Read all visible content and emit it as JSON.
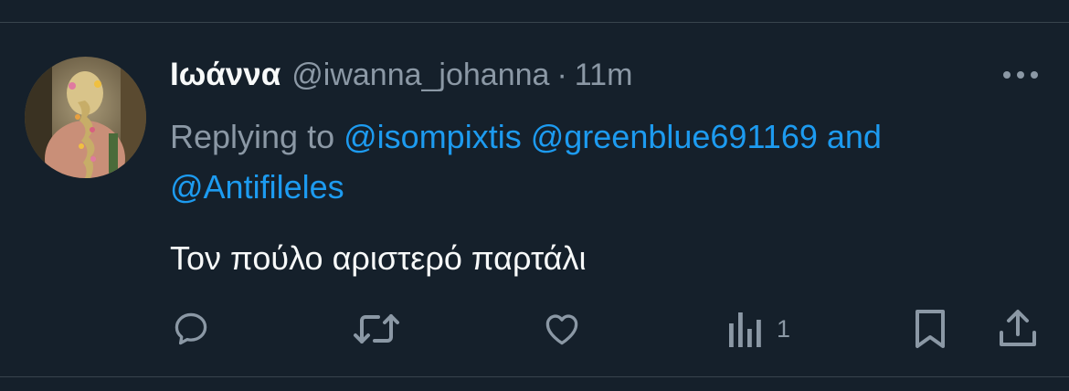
{
  "tweet": {
    "display_name": "Ιωάννα",
    "handle": "@iwanna_johanna",
    "separator": "·",
    "time": "11m",
    "replying_to": {
      "prefix": "Replying to",
      "mentions": [
        "@isompixtis",
        "@greenblue691169",
        "@Antifileles"
      ],
      "conjunction": "and"
    },
    "text": "Τον πούλο αριστερό παρτάλι"
  },
  "actions": {
    "reply_icon": "reply-icon",
    "retweet_icon": "retweet-icon",
    "like_icon": "like-icon",
    "views_icon": "views-icon",
    "views_count": "1",
    "bookmark_icon": "bookmark-icon",
    "share_icon": "share-icon"
  },
  "colors": {
    "background": "#15202b",
    "accent": "#1d9bf0",
    "muted": "#8b98a5",
    "text": "#f7f9f9"
  }
}
